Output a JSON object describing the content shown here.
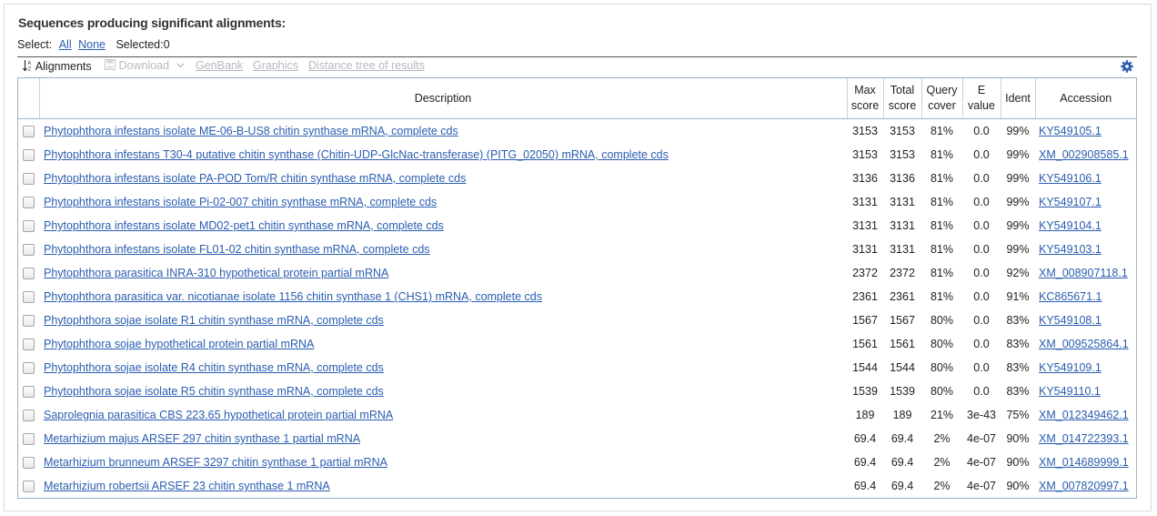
{
  "section_title": "Sequences producing significant alignments:",
  "select_bar": {
    "label": "Select:",
    "all": "All",
    "none": "None",
    "selected": "Selected:0"
  },
  "toolbar": {
    "alignments": "Alignments",
    "download": "Download",
    "genbank": "GenBank",
    "graphics": "Graphics",
    "distance_tree": "Distance tree of results",
    "gear_icon": "gear-icon",
    "sort_icon": "sort-icon",
    "accent_color": "#2a5db0",
    "disabled_color": "#b5b9c0"
  },
  "columns": {
    "description": "Description",
    "max_score": [
      "Max",
      "score"
    ],
    "total_score": [
      "Total",
      "score"
    ],
    "query_cover": [
      "Query",
      "cover"
    ],
    "e_value": [
      "E",
      "value"
    ],
    "ident": "Ident",
    "accession": "Accession"
  },
  "rows": [
    {
      "description": "Phytophthora infestans isolate ME-06-B-US8 chitin synthase mRNA, complete cds",
      "max": "3153",
      "total": "3153",
      "cover": "81%",
      "evalue": "0.0",
      "ident": "99%",
      "accession": "KY549105.1"
    },
    {
      "description": "Phytophthora infestans T30-4 putative chitin synthase (Chitin-UDP-GlcNac-transferase) (PITG_02050) mRNA, complete cds",
      "max": "3153",
      "total": "3153",
      "cover": "81%",
      "evalue": "0.0",
      "ident": "99%",
      "accession": "XM_002908585.1"
    },
    {
      "description": "Phytophthora infestans isolate PA-POD Tom/R chitin synthase mRNA, complete cds",
      "max": "3136",
      "total": "3136",
      "cover": "81%",
      "evalue": "0.0",
      "ident": "99%",
      "accession": "KY549106.1"
    },
    {
      "description": "Phytophthora infestans isolate Pi-02-007 chitin synthase mRNA, complete cds",
      "max": "3131",
      "total": "3131",
      "cover": "81%",
      "evalue": "0.0",
      "ident": "99%",
      "accession": "KY549107.1"
    },
    {
      "description": "Phytophthora infestans isolate MD02-pet1 chitin synthase mRNA, complete cds",
      "max": "3131",
      "total": "3131",
      "cover": "81%",
      "evalue": "0.0",
      "ident": "99%",
      "accession": "KY549104.1"
    },
    {
      "description": "Phytophthora infestans isolate FL01-02 chitin synthase mRNA, complete cds",
      "max": "3131",
      "total": "3131",
      "cover": "81%",
      "evalue": "0.0",
      "ident": "99%",
      "accession": "KY549103.1"
    },
    {
      "description": "Phytophthora parasitica INRA-310 hypothetical protein partial mRNA",
      "max": "2372",
      "total": "2372",
      "cover": "81%",
      "evalue": "0.0",
      "ident": "92%",
      "accession": "XM_008907118.1"
    },
    {
      "description": "Phytophthora parasitica var. nicotianae isolate 1156 chitin synthase 1 (CHS1) mRNA, complete cds",
      "max": "2361",
      "total": "2361",
      "cover": "81%",
      "evalue": "0.0",
      "ident": "91%",
      "accession": "KC865671.1"
    },
    {
      "description": "Phytophthora sojae isolate R1 chitin synthase mRNA, complete cds",
      "max": "1567",
      "total": "1567",
      "cover": "80%",
      "evalue": "0.0",
      "ident": "83%",
      "accession": "KY549108.1"
    },
    {
      "description": "Phytophthora sojae hypothetical protein partial mRNA",
      "max": "1561",
      "total": "1561",
      "cover": "80%",
      "evalue": "0.0",
      "ident": "83%",
      "accession": "XM_009525864.1"
    },
    {
      "description": "Phytophthora sojae isolate R4 chitin synthase mRNA, complete cds",
      "max": "1544",
      "total": "1544",
      "cover": "80%",
      "evalue": "0.0",
      "ident": "83%",
      "accession": "KY549109.1"
    },
    {
      "description": "Phytophthora sojae isolate R5 chitin synthase mRNA, complete cds",
      "max": "1539",
      "total": "1539",
      "cover": "80%",
      "evalue": "0.0",
      "ident": "83%",
      "accession": "KY549110.1"
    },
    {
      "description": "Saprolegnia parasitica CBS 223.65 hypothetical protein partial mRNA",
      "max": "189",
      "total": "189",
      "cover": "21%",
      "evalue": "3e-43",
      "ident": "75%",
      "accession": "XM_012349462.1"
    },
    {
      "description": "Metarhizium majus ARSEF 297 chitin synthase 1 partial mRNA",
      "max": "69.4",
      "total": "69.4",
      "cover": "2%",
      "evalue": "4e-07",
      "ident": "90%",
      "accession": "XM_014722393.1"
    },
    {
      "description": "Metarhizium brunneum ARSEF 3297 chitin synthase 1 partial mRNA",
      "max": "69.4",
      "total": "69.4",
      "cover": "2%",
      "evalue": "4e-07",
      "ident": "90%",
      "accession": "XM_014689999.1"
    },
    {
      "description": "Metarhizium robertsii ARSEF 23 chitin synthase 1 mRNA",
      "max": "69.4",
      "total": "69.4",
      "cover": "2%",
      "evalue": "4e-07",
      "ident": "90%",
      "accession": "XM_007820997.1"
    }
  ]
}
